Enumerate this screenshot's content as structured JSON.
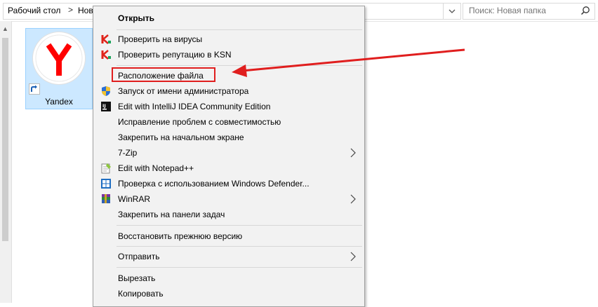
{
  "address": {
    "crumbs": [
      "Рабочий стол",
      "Нов"
    ],
    "separators": [
      ">",
      ">"
    ]
  },
  "search": {
    "placeholder": "Поиск: Новая папка"
  },
  "file": {
    "name": "Yandex"
  },
  "menu": {
    "items": [
      {
        "label": "Открыть",
        "bold": true
      },
      {
        "label": "Проверить на вирусы"
      },
      {
        "label": "Проверить репутацию в KSN"
      },
      {
        "label": "Расположение файла"
      },
      {
        "label": "Запуск от имени администратора"
      },
      {
        "label": "Edit with IntelliJ IDEA Community Edition"
      },
      {
        "label": "Исправление проблем с совместимостью"
      },
      {
        "label": "Закрепить на начальном экране"
      },
      {
        "label": "7-Zip"
      },
      {
        "label": "Edit with Notepad++"
      },
      {
        "label": "Проверка с использованием Windows Defender..."
      },
      {
        "label": "WinRAR"
      },
      {
        "label": "Закрепить на панели задач"
      },
      {
        "label": "Восстановить прежнюю версию"
      },
      {
        "label": "Отправить"
      },
      {
        "label": "Вырезать"
      },
      {
        "label": "Копировать"
      }
    ],
    "submenu_arrow": ">",
    "idea_icon_text": "IJ"
  },
  "colors": {
    "highlight": "#e01e1e",
    "selection": "#cce8ff",
    "yandex_red": "#ff0000"
  }
}
